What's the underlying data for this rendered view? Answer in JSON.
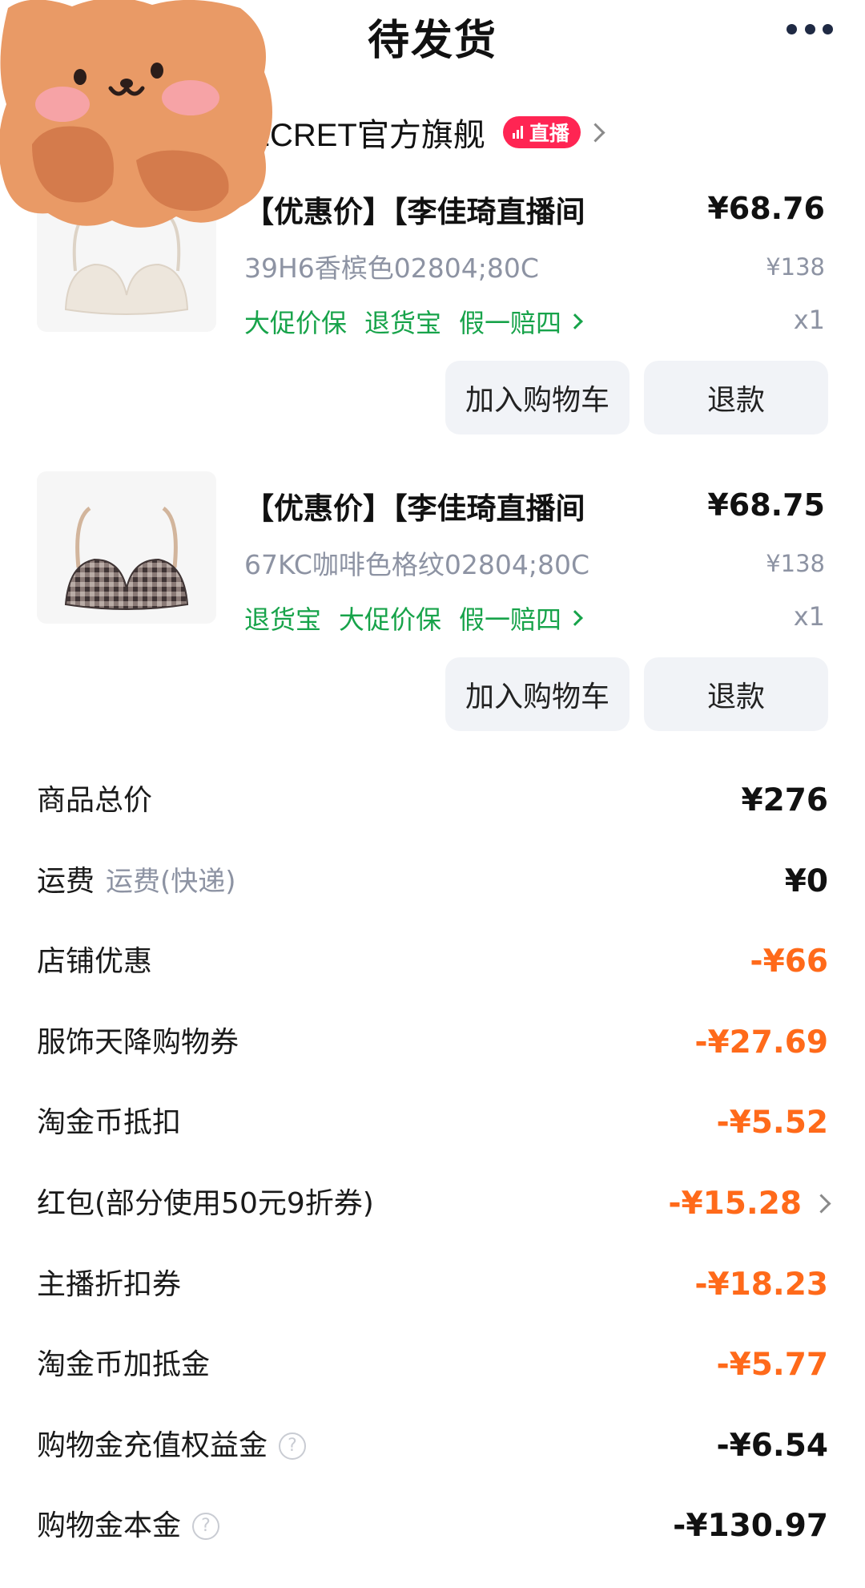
{
  "header": {
    "title": "待发货"
  },
  "store": {
    "name": "VICTORIA'S SECRET官方旗舰",
    "live_badge": "直播"
  },
  "products": [
    {
      "name": "【优惠价】【李佳琦直播间",
      "price": "¥68.76",
      "sku": "39H6香槟色02804;80C",
      "original_price": "¥138",
      "tags": [
        "大促价保",
        "退货宝",
        "假一赔四"
      ],
      "qty": "x1",
      "cart_label": "加入购物车",
      "refund_label": "退款",
      "image": "cream-bra"
    },
    {
      "name": "【优惠价】【李佳琦直播间",
      "price": "¥68.75",
      "sku": "67KC咖啡色格纹02804;80C",
      "original_price": "¥138",
      "tags": [
        "退货宝",
        "大促价保",
        "假一赔四"
      ],
      "qty": "x1",
      "cart_label": "加入购物车",
      "refund_label": "退款",
      "image": "plaid-bra"
    }
  ],
  "summary": [
    {
      "label": "商品总价",
      "sub": "",
      "value": "¥276",
      "style": "dark"
    },
    {
      "label": "运费",
      "sub": "运费(快递)",
      "value": "¥0",
      "style": "dark"
    },
    {
      "label": "店铺优惠",
      "sub": "",
      "value": "-¥66",
      "style": "orange"
    },
    {
      "label": "服饰天降购物券",
      "sub": "",
      "value": "-¥27.69",
      "style": "orange"
    },
    {
      "label": "淘金币抵扣",
      "sub": "",
      "value": "-¥5.52",
      "style": "orange"
    },
    {
      "label": "红包(部分使用50元9折券)",
      "sub": "",
      "value": "-¥15.28",
      "style": "orange"
    },
    {
      "label": "主播折扣券",
      "sub": "",
      "value": "-¥18.23",
      "style": "orange"
    },
    {
      "label": "淘金币加抵金",
      "sub": "",
      "value": "-¥5.77",
      "style": "orange"
    },
    {
      "label": "购物金充值权益金",
      "sub": "",
      "value": "-¥6.54",
      "style": "dark"
    },
    {
      "label": "购物金本金",
      "sub": "",
      "value": "-¥130.97",
      "style": "dark"
    }
  ],
  "colors": {
    "orange": "#ff6a1a",
    "green": "#17a34a",
    "live_red": "#ff2553"
  }
}
